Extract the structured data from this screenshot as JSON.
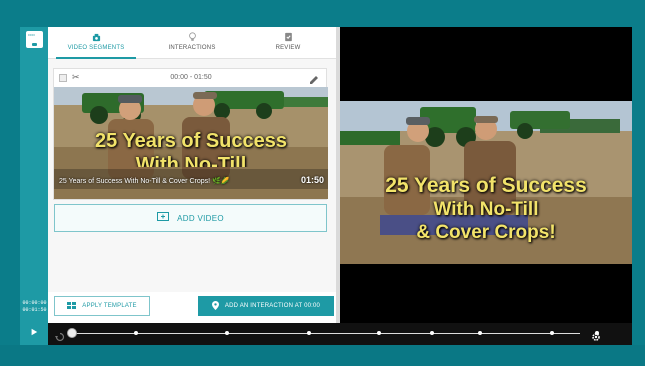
{
  "tabs": [
    {
      "label": "VIDEO SEGMENTS",
      "icon": "camera-icon",
      "active": true
    },
    {
      "label": "INTERACTIONS",
      "icon": "lightbulb-icon",
      "active": false
    },
    {
      "label": "REVIEW",
      "icon": "checklist-icon",
      "active": false
    }
  ],
  "segment": {
    "range": "00:00 - 01:50",
    "title": "25 Years of Success With No-Till & Cover Crops! 🌿🌽",
    "duration": "01:50",
    "thumb_line1": "25 Years of Success",
    "thumb_line2": "With No-Till"
  },
  "buttons": {
    "add_video": "ADD VIDEO",
    "apply_template": "APPLY TEMPLATE",
    "add_interaction": "ADD AN INTERACTION AT 00:00"
  },
  "video": {
    "line1": "25 Years of Success",
    "line2": "With No-Till",
    "line3": "& Cover Crops!"
  },
  "time": {
    "current": "00:00:00",
    "total": "00:01:50"
  },
  "playback_progress": 0,
  "colors": {
    "accent": "#1e9aa5",
    "frame": "#0b7d8a",
    "title_text": "#f2e36a"
  }
}
